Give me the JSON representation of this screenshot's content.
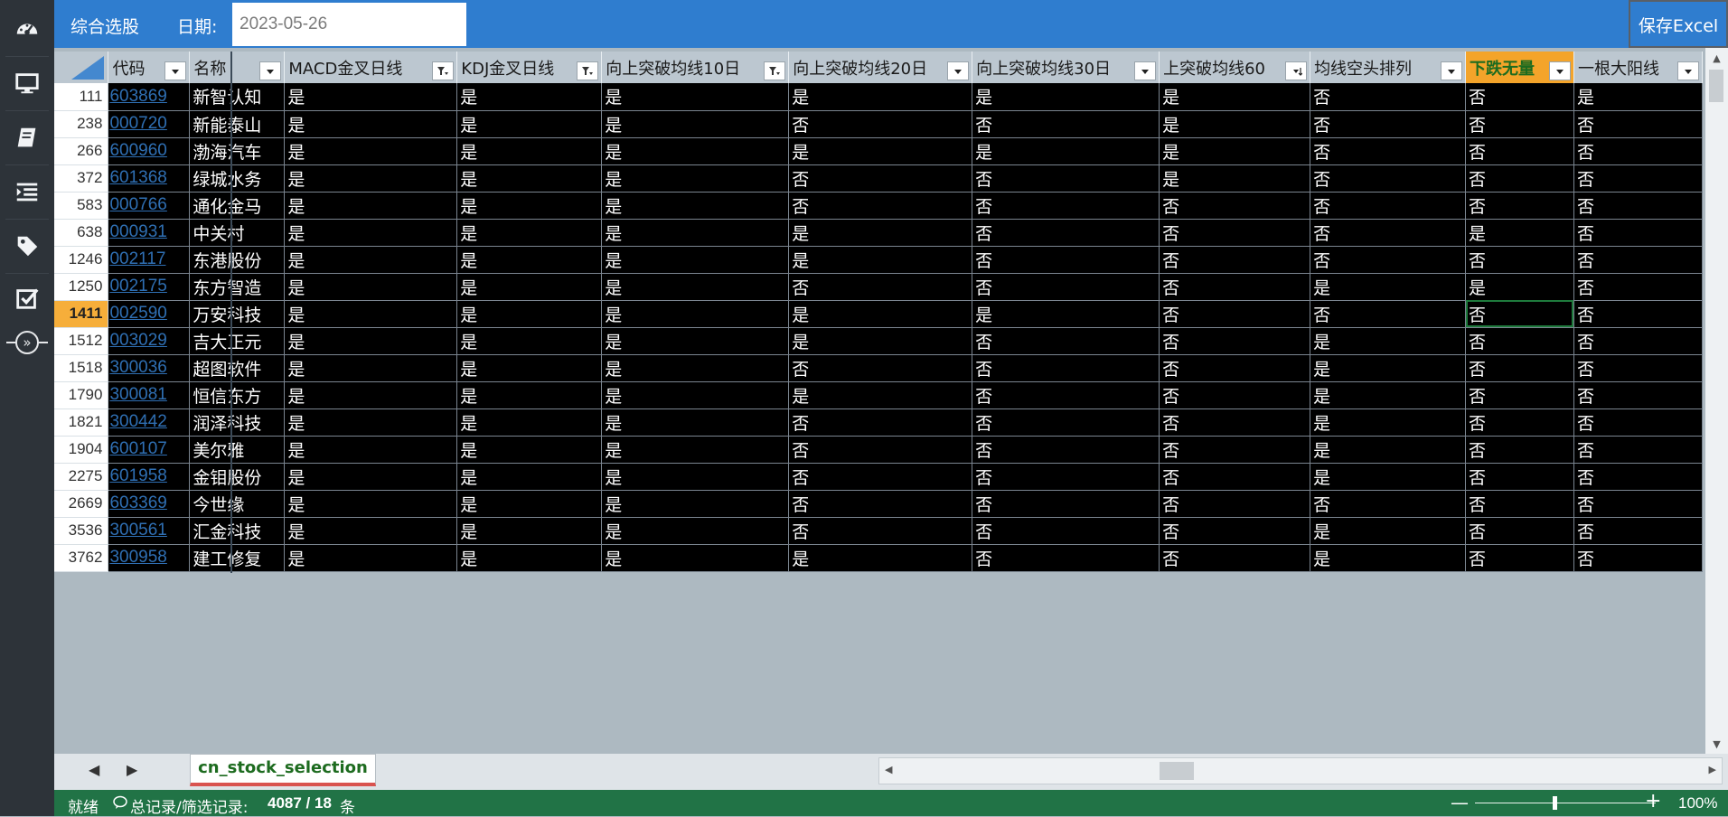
{
  "toolbar": {
    "title": "综合选股",
    "date_label": "日期:",
    "date_value": "2023-05-26",
    "save_label": "保存Excel"
  },
  "nav": [
    {
      "icon": "dashboard-icon"
    },
    {
      "icon": "monitor-icon"
    },
    {
      "icon": "book-icon"
    },
    {
      "icon": "list-indent-icon"
    },
    {
      "icon": "tag-icon"
    },
    {
      "icon": "checkbox-icon"
    },
    {
      "icon": "expand-chevrons-icon"
    }
  ],
  "table": {
    "columns": [
      {
        "label": "代码",
        "filter": "dropdown"
      },
      {
        "label": "名称",
        "filter": "dropdown"
      },
      {
        "label": "MACD金叉日线",
        "filter": "filtered"
      },
      {
        "label": "KDJ金叉日线",
        "filter": "filtered"
      },
      {
        "label": "向上突破均线10日",
        "filter": "filtered"
      },
      {
        "label": "向上突破均线20日",
        "filter": "dropdown"
      },
      {
        "label": "向上突破均线30日",
        "filter": "dropdown"
      },
      {
        "label": "上突破均线60",
        "filter": "sorted"
      },
      {
        "label": "均线空头排列",
        "filter": "dropdown"
      },
      {
        "label": "下跌无量",
        "filter": "dropdown"
      },
      {
        "label": "一根大阳线",
        "filter": "dropdown"
      }
    ],
    "active_column_index": 9,
    "active_row_index": 8,
    "rows": [
      {
        "n": "111",
        "code": "603869",
        "name": "新智认知",
        "v": [
          "是",
          "是",
          "是",
          "是",
          "是",
          "是",
          "否",
          "否",
          "是"
        ]
      },
      {
        "n": "238",
        "code": "000720",
        "name": "新能泰山",
        "v": [
          "是",
          "是",
          "是",
          "否",
          "否",
          "是",
          "否",
          "否",
          "否"
        ]
      },
      {
        "n": "266",
        "code": "600960",
        "name": "渤海汽车",
        "v": [
          "是",
          "是",
          "是",
          "是",
          "是",
          "是",
          "否",
          "否",
          "否"
        ]
      },
      {
        "n": "372",
        "code": "601368",
        "name": "绿城水务",
        "v": [
          "是",
          "是",
          "是",
          "否",
          "否",
          "是",
          "否",
          "否",
          "否"
        ]
      },
      {
        "n": "583",
        "code": "000766",
        "name": "通化金马",
        "v": [
          "是",
          "是",
          "是",
          "否",
          "否",
          "否",
          "否",
          "否",
          "否"
        ]
      },
      {
        "n": "638",
        "code": "000931",
        "name": "中关村",
        "v": [
          "是",
          "是",
          "是",
          "是",
          "否",
          "否",
          "否",
          "是",
          "否"
        ]
      },
      {
        "n": "1246",
        "code": "002117",
        "name": "东港股份",
        "v": [
          "是",
          "是",
          "是",
          "是",
          "否",
          "否",
          "否",
          "否",
          "否"
        ]
      },
      {
        "n": "1250",
        "code": "002175",
        "name": "东方智造",
        "v": [
          "是",
          "是",
          "是",
          "否",
          "否",
          "否",
          "是",
          "是",
          "否"
        ]
      },
      {
        "n": "1411",
        "code": "002590",
        "name": "万安科技",
        "v": [
          "是",
          "是",
          "是",
          "是",
          "是",
          "否",
          "否",
          "否",
          "否"
        ]
      },
      {
        "n": "1512",
        "code": "003029",
        "name": "吉大正元",
        "v": [
          "是",
          "是",
          "是",
          "是",
          "否",
          "否",
          "是",
          "否",
          "否"
        ]
      },
      {
        "n": "1518",
        "code": "300036",
        "name": "超图软件",
        "v": [
          "是",
          "是",
          "是",
          "否",
          "否",
          "否",
          "是",
          "否",
          "否"
        ]
      },
      {
        "n": "1790",
        "code": "300081",
        "name": "恒信东方",
        "v": [
          "是",
          "是",
          "是",
          "是",
          "否",
          "否",
          "是",
          "否",
          "否"
        ]
      },
      {
        "n": "1821",
        "code": "300442",
        "name": "润泽科技",
        "v": [
          "是",
          "是",
          "是",
          "否",
          "否",
          "否",
          "是",
          "否",
          "否"
        ]
      },
      {
        "n": "1904",
        "code": "600107",
        "name": "美尔雅",
        "v": [
          "是",
          "是",
          "是",
          "否",
          "否",
          "否",
          "是",
          "否",
          "否"
        ]
      },
      {
        "n": "2275",
        "code": "601958",
        "name": "金钼股份",
        "v": [
          "是",
          "是",
          "是",
          "否",
          "否",
          "否",
          "是",
          "否",
          "否"
        ]
      },
      {
        "n": "2669",
        "code": "603369",
        "name": "今世缘",
        "v": [
          "是",
          "是",
          "是",
          "否",
          "否",
          "否",
          "否",
          "否",
          "否"
        ]
      },
      {
        "n": "3536",
        "code": "300561",
        "name": "汇金科技",
        "v": [
          "是",
          "是",
          "是",
          "否",
          "否",
          "否",
          "是",
          "否",
          "否"
        ]
      },
      {
        "n": "3762",
        "code": "300958",
        "name": "建工修复",
        "v": [
          "是",
          "是",
          "是",
          "是",
          "否",
          "否",
          "是",
          "否",
          "否"
        ]
      }
    ]
  },
  "sheet": {
    "tab_label": "cn_stock_selection"
  },
  "status": {
    "ready": "就绪",
    "records_label": "总记录/筛选记录:",
    "records_value": "4087 / 18",
    "records_unit": "条",
    "zoom_pct": "100%",
    "zoom_level": 1.0
  }
}
